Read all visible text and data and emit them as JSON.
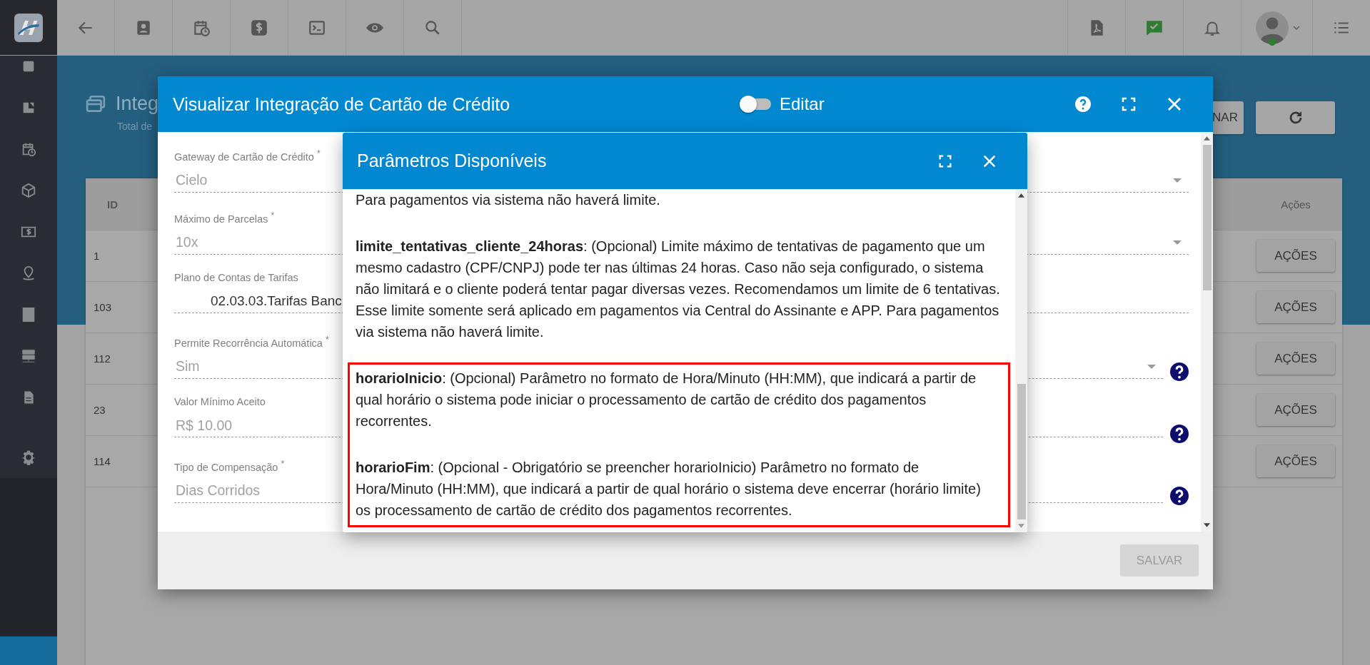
{
  "page": {
    "title": "Integ",
    "subtitle": "Total de",
    "buttons": [
      "NAR"
    ]
  },
  "table": {
    "columns": [
      "ID",
      "Ações"
    ],
    "rows": [
      {
        "id": "1",
        "action": "AÇÕES"
      },
      {
        "id": "103",
        "action": "AÇÕES"
      },
      {
        "id": "112",
        "action": "AÇÕES"
      },
      {
        "id": "23",
        "action": "AÇÕES"
      },
      {
        "id": "114",
        "action": "AÇÕES"
      }
    ]
  },
  "modal": {
    "title": "Visualizar Integração de Cartão de Crédito",
    "edit_toggle": {
      "label": "Editar",
      "on": false
    },
    "fields": [
      {
        "label": "Gateway de Cartão de Crédito $^{*}$",
        "value": "Cielo",
        "kind": "select",
        "help": false
      },
      {
        "label": "Máximo de Parcelas $^{*}$",
        "value": "10x",
        "kind": "select",
        "help": false
      },
      {
        "label": "Plano de Contas de Tarifas",
        "value": "02.03.03.Tarifas Banc",
        "kind": "autocomplete",
        "help": false
      },
      {
        "label": "Permite Recorrência Automática $^{*}$",
        "value": "Sim",
        "kind": "select",
        "help": true
      },
      {
        "label": "Valor Mínimo Aceito",
        "value": "R$ 10.00",
        "kind": "text",
        "help": true
      },
      {
        "label": "Tipo de Compensação $^{*}$",
        "value": "Dias Corridos",
        "kind": "text",
        "help": true
      }
    ],
    "save_button": {
      "label": "SALVAR",
      "disabled": true
    }
  },
  "dialog": {
    "title": "Parâmetros Disponíveis",
    "sections": [
      {
        "kind": "plain",
        "paragraphs": [
          "Para pagamentos via sistema não haverá limite.",
          "**limite_tentativas_cliente_24horas**: (Opcional) Limite máximo de tentativas de pagamento que um mesmo cadastro (CPF/CNPJ) pode ter nas últimas 24 horas. Caso não seja configurado, o sistema não limitará e o cliente poderá tentar pagar diversas vezes. Recomendamos um limite de 6 tentativas. Esse limite somente será aplicado em pagamentos via Central do Assinante e APP. Para pagamentos via sistema não haverá limite."
        ]
      },
      {
        "kind": "highlighted",
        "paragraphs": [
          "**horarioInicio**: (Opcional) Parâmetro no formato de Hora/Minuto (HH:MM), que indicará a partir de qual horário o sistema pode iniciar o processamento de cartão de crédito dos pagamentos recorrentes.",
          "**horarioFim**: (Opcional - Obrigatório se preencher horarioInicio) Parâmetro no formato de Hora/Minuto (HH:MM), que indicará a partir de qual horário o sistema deve encerrar (horário limite) os processamento de cartão de crédito dos pagamentos recorrentes."
        ]
      }
    ]
  }
}
